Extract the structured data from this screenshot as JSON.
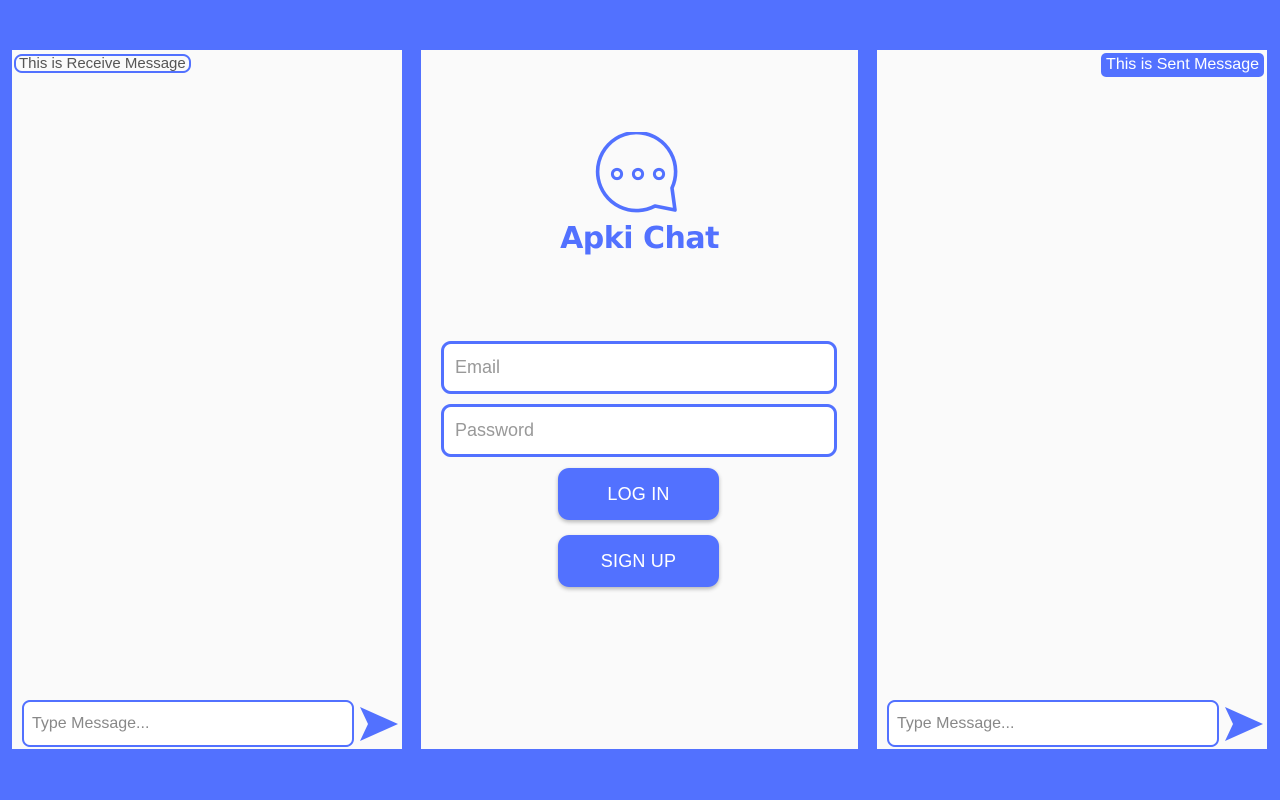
{
  "colors": {
    "brand": "#5271ff",
    "panel_background": "#fafafa",
    "placeholder_text": "#999999",
    "received_text": "#555555",
    "sent_text": "#ffffff"
  },
  "receive_screen": {
    "message": "This is Receive Message",
    "composer_placeholder": "Type Message...",
    "send_icon": "send-icon"
  },
  "login_screen": {
    "logo_icon": "chat-bubble-icon",
    "app_name": "Apki Chat",
    "email_placeholder": "Email",
    "password_placeholder": "Password",
    "login_label": "LOG IN",
    "signup_label": "SIGN UP"
  },
  "send_screen": {
    "message": "This is Sent Message",
    "composer_placeholder": "Type Message...",
    "send_icon": "send-icon"
  }
}
